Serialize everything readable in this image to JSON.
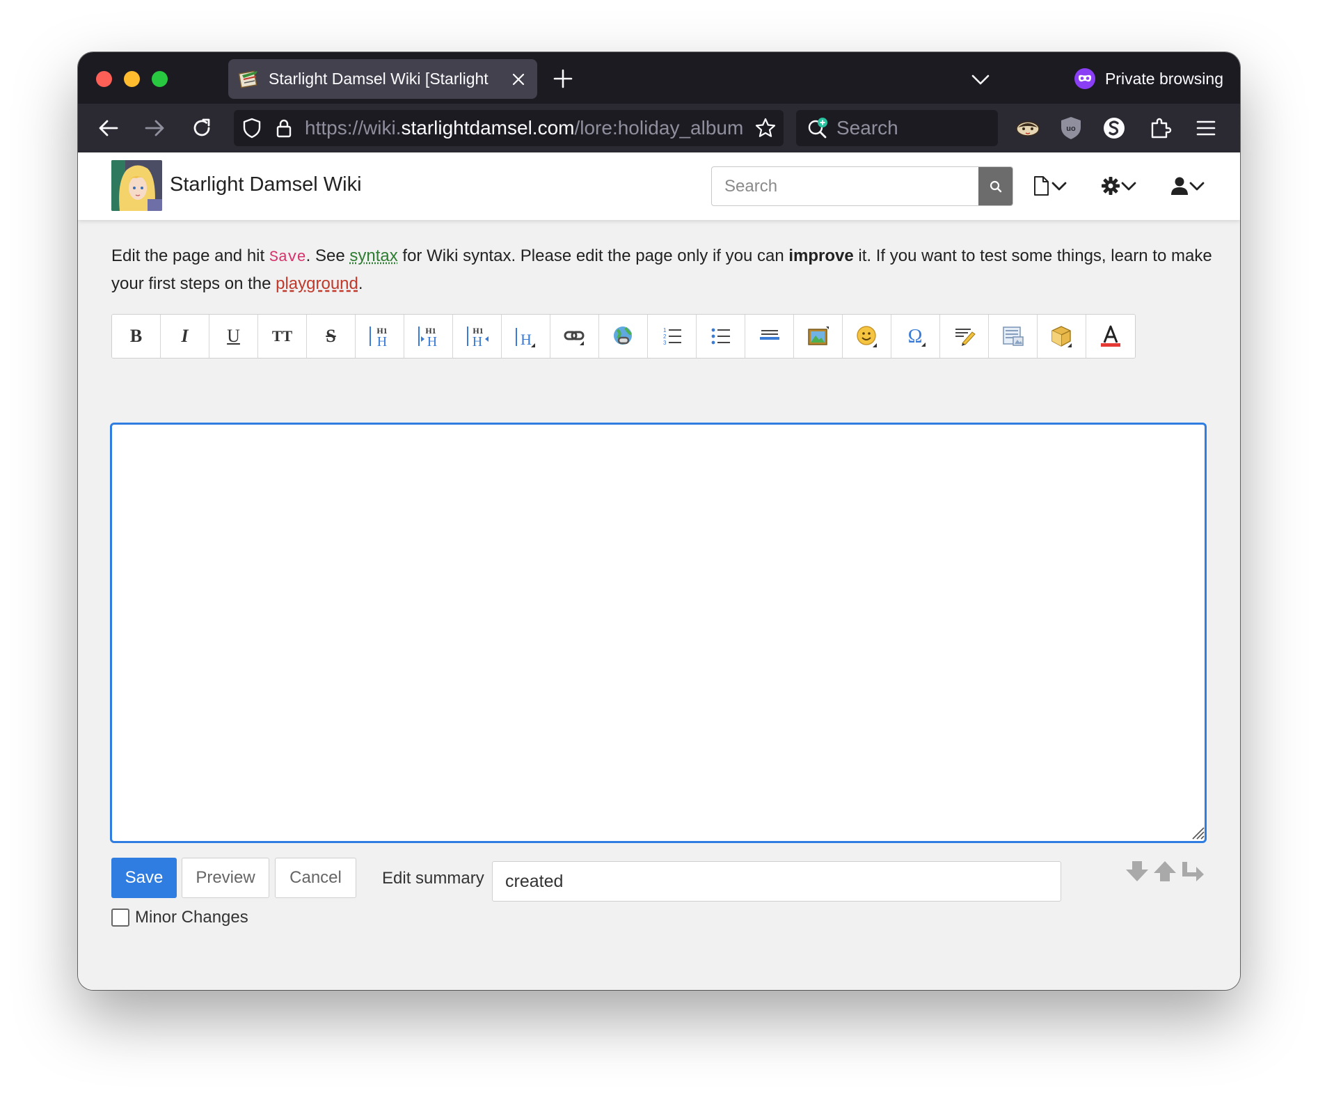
{
  "browser": {
    "tab_title": "Starlight Damsel Wiki [Starlight",
    "private_label": "Private browsing",
    "url_scheme": "https://wiki.",
    "url_host": "starlightdamsel.com",
    "url_path": "/lore:holiday_album",
    "search_placeholder": "Search"
  },
  "wiki": {
    "site_title": "Starlight Damsel Wiki",
    "search_placeholder": "Search"
  },
  "intro": {
    "t1": "Edit the page and hit ",
    "save": "Save",
    "t2": ". See ",
    "syntax": "syntax",
    "t3": " for Wiki syntax. Please edit the page only if you can ",
    "improve": "improve",
    "t4": " it. If you want to test some things, learn to make your first steps on the ",
    "playground": "playground",
    "t5": "."
  },
  "toolbar": {
    "bold": "B",
    "italic": "I",
    "underline": "U",
    "mono": "TT",
    "strike": "S"
  },
  "editor": {
    "content": ""
  },
  "form": {
    "save_label": "Save",
    "preview_label": "Preview",
    "cancel_label": "Cancel",
    "summary_label": "Edit summary",
    "summary_value": "created",
    "minor_label": "Minor Changes",
    "minor_checked": false
  },
  "colors": {
    "accent": "#2f7de1",
    "save_ref": "#d6336c",
    "syntax_link": "#2e7d32",
    "playground_link": "#c0392b"
  }
}
